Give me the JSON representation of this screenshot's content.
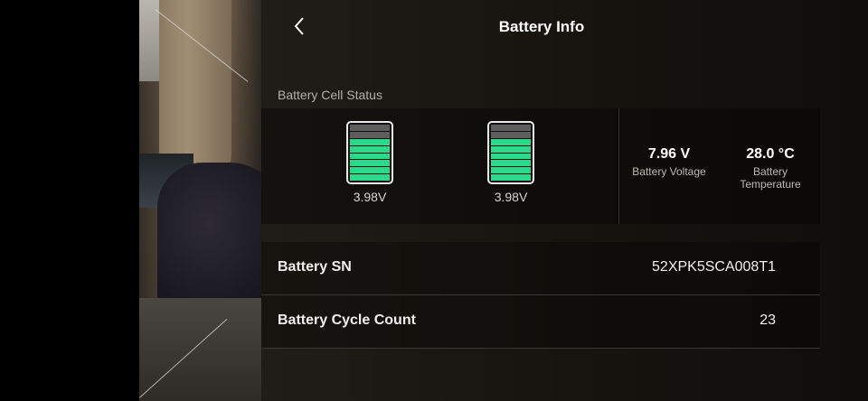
{
  "header": {
    "title": "Battery Info"
  },
  "cells": {
    "section_label": "Battery Cell Status",
    "items": [
      {
        "voltage": "3.98V",
        "level": 0.75
      },
      {
        "voltage": "3.98V",
        "level": 0.75
      }
    ]
  },
  "stats": {
    "voltage_value": "7.96 V",
    "voltage_label": "Battery Voltage",
    "temperature_value": "28.0 °C",
    "temperature_label_line1": "Battery",
    "temperature_label_line2": "Temperature"
  },
  "rows": [
    {
      "label": "Battery SN",
      "value": "52XPK5SCA008T1"
    },
    {
      "label": "Battery Cycle Count",
      "value": "23"
    }
  ],
  "colors": {
    "cell_fill": "#2ad98a",
    "cell_empty": "#5d5d5d"
  },
  "icons": {
    "back": "chevron-left-icon"
  }
}
